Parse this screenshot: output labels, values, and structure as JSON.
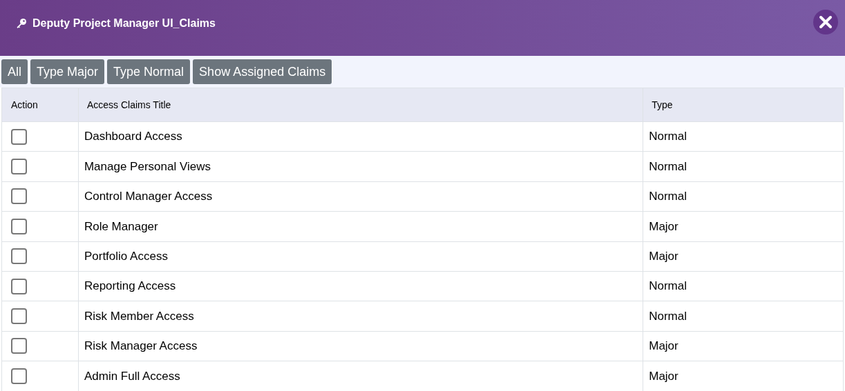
{
  "window": {
    "title": "Deputy Project Manager UI_Claims"
  },
  "filters": [
    {
      "label": "All"
    },
    {
      "label": "Type Major"
    },
    {
      "label": "Type Normal"
    },
    {
      "label": "Show Assigned Claims"
    }
  ],
  "table": {
    "columns": [
      "Action",
      "Access Claims Title",
      "Type"
    ],
    "rows": [
      {
        "checked": false,
        "title": "Dashboard Access",
        "type": "Normal"
      },
      {
        "checked": false,
        "title": "Manage Personal Views",
        "type": "Normal"
      },
      {
        "checked": false,
        "title": "Control Manager Access",
        "type": "Normal"
      },
      {
        "checked": false,
        "title": "Role Manager",
        "type": "Major"
      },
      {
        "checked": false,
        "title": "Portfolio Access",
        "type": "Major"
      },
      {
        "checked": false,
        "title": "Reporting Access",
        "type": "Normal"
      },
      {
        "checked": false,
        "title": "Risk Member Access",
        "type": "Normal"
      },
      {
        "checked": false,
        "title": "Risk Manager Access",
        "type": "Major"
      },
      {
        "checked": false,
        "title": "Admin Full Access",
        "type": "Major"
      }
    ]
  }
}
